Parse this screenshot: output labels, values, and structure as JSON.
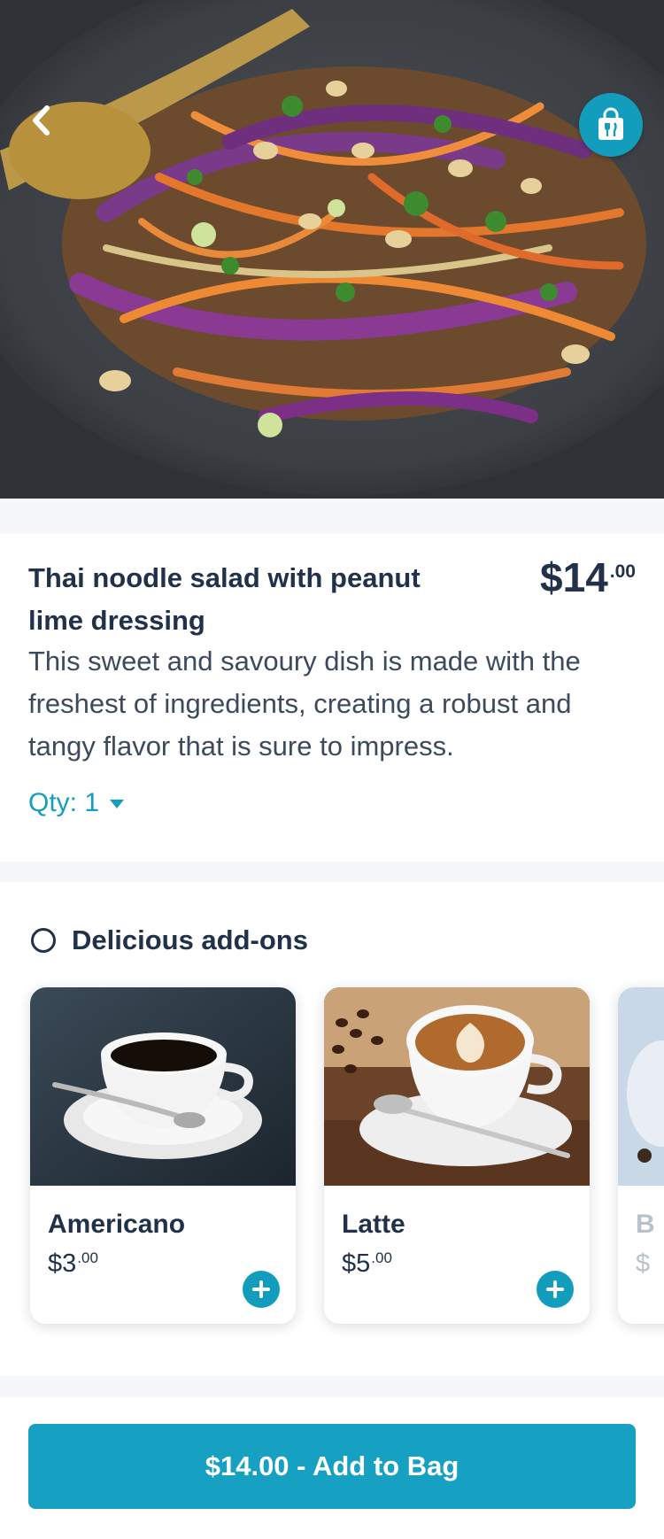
{
  "colors": {
    "accent": "#139dbd",
    "text": "#22314a",
    "page_bg": "#f5f7fa"
  },
  "hero": {
    "back_icon": "chevron-left-icon",
    "bag_icon": "shopping-bag-icon"
  },
  "product": {
    "title": "Thai noodle salad with peanut lime dressing",
    "price_main": "$14",
    "price_cents": ".00",
    "description": "This sweet and savoury dish is made with the freshest of ingredients, creating a robust and tangy flavor that is sure to impress.",
    "qty_label": "Qty: 1"
  },
  "addons": {
    "title": "Delicious add-ons",
    "items": [
      {
        "name": "Americano",
        "price_main": "$3",
        "price_cents": ".00"
      },
      {
        "name": "Latte",
        "price_main": "$5",
        "price_cents": ".00"
      },
      {
        "name": "B",
        "price_main": "$",
        "price_cents": ""
      }
    ]
  },
  "cta": {
    "label": "$14.00 - Add to Bag"
  }
}
